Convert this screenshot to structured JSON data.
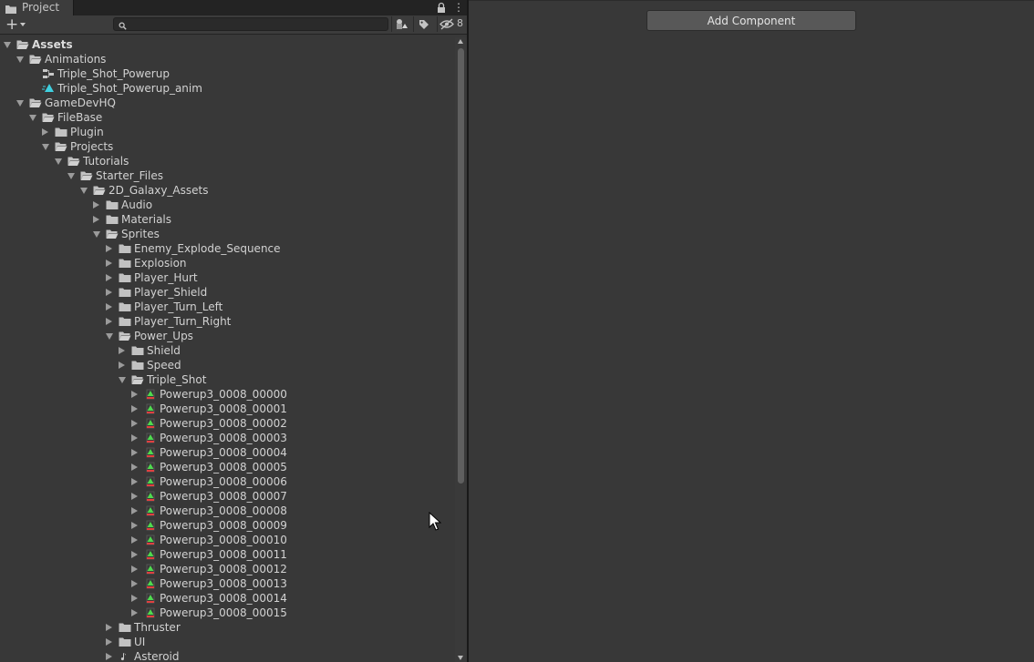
{
  "project_tab": {
    "label": "Project",
    "icon": "folder-icon"
  },
  "toolbar": {
    "create_icon": "plus-icon",
    "search_placeholder": "",
    "hidden_packages_count": "8"
  },
  "tree": [
    {
      "label": "Assets",
      "depth": 0,
      "expander": "open",
      "icon": "folder-open",
      "bold": true
    },
    {
      "label": "Animations",
      "depth": 1,
      "expander": "open",
      "icon": "folder-open"
    },
    {
      "label": "Triple_Shot_Powerup",
      "depth": 2,
      "expander": "none",
      "icon": "animator-controller"
    },
    {
      "label": "Triple_Shot_Powerup_anim",
      "depth": 2,
      "expander": "none",
      "icon": "animation-clip"
    },
    {
      "label": "GameDevHQ",
      "depth": 1,
      "expander": "open",
      "icon": "folder-open"
    },
    {
      "label": "FileBase",
      "depth": 2,
      "expander": "open",
      "icon": "folder-open"
    },
    {
      "label": "Plugin",
      "depth": 3,
      "expander": "closed",
      "icon": "folder"
    },
    {
      "label": "Projects",
      "depth": 3,
      "expander": "open",
      "icon": "folder-open"
    },
    {
      "label": "Tutorials",
      "depth": 4,
      "expander": "open",
      "icon": "folder-open"
    },
    {
      "label": "Starter_Files",
      "depth": 5,
      "expander": "open",
      "icon": "folder-open"
    },
    {
      "label": "2D_Galaxy_Assets",
      "depth": 6,
      "expander": "open",
      "icon": "folder-open"
    },
    {
      "label": "Audio",
      "depth": 7,
      "expander": "closed",
      "icon": "folder"
    },
    {
      "label": "Materials",
      "depth": 7,
      "expander": "closed",
      "icon": "folder"
    },
    {
      "label": "Sprites",
      "depth": 7,
      "expander": "open",
      "icon": "folder-open"
    },
    {
      "label": "Enemy_Explode_Sequence",
      "depth": 8,
      "expander": "closed",
      "icon": "folder"
    },
    {
      "label": "Explosion",
      "depth": 8,
      "expander": "closed",
      "icon": "folder"
    },
    {
      "label": "Player_Hurt",
      "depth": 8,
      "expander": "closed",
      "icon": "folder"
    },
    {
      "label": "Player_Shield",
      "depth": 8,
      "expander": "closed",
      "icon": "folder"
    },
    {
      "label": "Player_Turn_Left",
      "depth": 8,
      "expander": "closed",
      "icon": "folder"
    },
    {
      "label": "Player_Turn_Right",
      "depth": 8,
      "expander": "closed",
      "icon": "folder"
    },
    {
      "label": "Power_Ups",
      "depth": 8,
      "expander": "open",
      "icon": "folder-open"
    },
    {
      "label": "Shield",
      "depth": 9,
      "expander": "closed",
      "icon": "folder"
    },
    {
      "label": "Speed",
      "depth": 9,
      "expander": "closed",
      "icon": "folder"
    },
    {
      "label": "Triple_Shot",
      "depth": 9,
      "expander": "open",
      "icon": "folder-open"
    },
    {
      "label": "Powerup3_0008_00000",
      "depth": 10,
      "expander": "closed",
      "icon": "sprite"
    },
    {
      "label": "Powerup3_0008_00001",
      "depth": 10,
      "expander": "closed",
      "icon": "sprite"
    },
    {
      "label": "Powerup3_0008_00002",
      "depth": 10,
      "expander": "closed",
      "icon": "sprite"
    },
    {
      "label": "Powerup3_0008_00003",
      "depth": 10,
      "expander": "closed",
      "icon": "sprite"
    },
    {
      "label": "Powerup3_0008_00004",
      "depth": 10,
      "expander": "closed",
      "icon": "sprite"
    },
    {
      "label": "Powerup3_0008_00005",
      "depth": 10,
      "expander": "closed",
      "icon": "sprite"
    },
    {
      "label": "Powerup3_0008_00006",
      "depth": 10,
      "expander": "closed",
      "icon": "sprite"
    },
    {
      "label": "Powerup3_0008_00007",
      "depth": 10,
      "expander": "closed",
      "icon": "sprite"
    },
    {
      "label": "Powerup3_0008_00008",
      "depth": 10,
      "expander": "closed",
      "icon": "sprite"
    },
    {
      "label": "Powerup3_0008_00009",
      "depth": 10,
      "expander": "closed",
      "icon": "sprite"
    },
    {
      "label": "Powerup3_0008_00010",
      "depth": 10,
      "expander": "closed",
      "icon": "sprite"
    },
    {
      "label": "Powerup3_0008_00011",
      "depth": 10,
      "expander": "closed",
      "icon": "sprite"
    },
    {
      "label": "Powerup3_0008_00012",
      "depth": 10,
      "expander": "closed",
      "icon": "sprite"
    },
    {
      "label": "Powerup3_0008_00013",
      "depth": 10,
      "expander": "closed",
      "icon": "sprite"
    },
    {
      "label": "Powerup3_0008_00014",
      "depth": 10,
      "expander": "closed",
      "icon": "sprite"
    },
    {
      "label": "Powerup3_0008_00015",
      "depth": 10,
      "expander": "closed",
      "icon": "sprite"
    },
    {
      "label": "Thruster",
      "depth": 8,
      "expander": "closed",
      "icon": "folder"
    },
    {
      "label": "UI",
      "depth": 8,
      "expander": "closed",
      "icon": "folder"
    },
    {
      "label": "Asteroid",
      "depth": 8,
      "expander": "closed",
      "icon": "audio-clip"
    }
  ],
  "inspector": {
    "add_component_label": "Add Component"
  },
  "colors": {
    "panel_bg": "#383838",
    "tab_bar_bg": "#232323",
    "text": "#d2d2d2",
    "button_bg": "#585858",
    "sprite_green": "#4fd94f",
    "sprite_red": "#e04040",
    "anim_cyan": "#3fd0e0"
  }
}
